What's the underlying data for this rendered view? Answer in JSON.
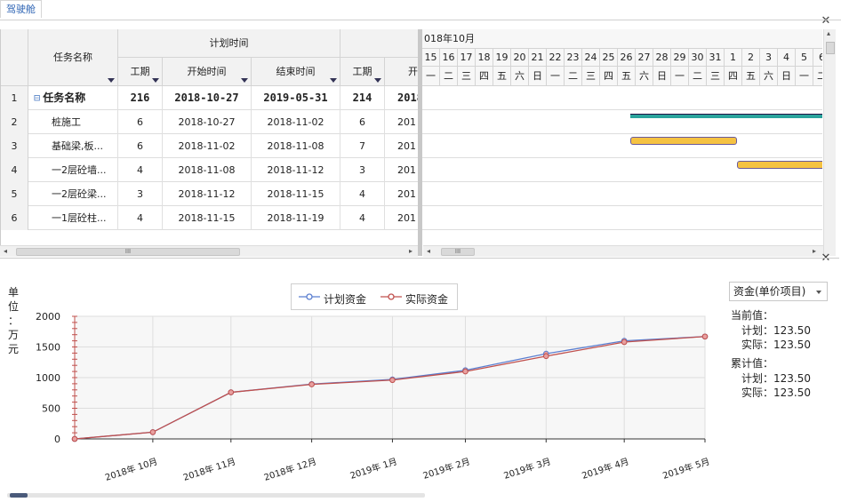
{
  "tab": {
    "label": "驾驶舱"
  },
  "grid": {
    "headers": {
      "task_name": "任务名称",
      "plan_time": "计划时间",
      "duration": "工期",
      "start": "开始时间",
      "end": "结束时间",
      "duration2": "工期",
      "start2_partial": "开"
    },
    "rows": [
      {
        "num": "1",
        "name": "任务名称",
        "duration": "216",
        "start": "2018-10-27",
        "end": "2019-05-31",
        "duration2": "214",
        "start2": "2018",
        "summary": true
      },
      {
        "num": "2",
        "name": "桩施工",
        "duration": "6",
        "start": "2018-10-27",
        "end": "2018-11-02",
        "duration2": "6",
        "start2": "201"
      },
      {
        "num": "3",
        "name": "基础梁,板...",
        "duration": "6",
        "start": "2018-11-02",
        "end": "2018-11-08",
        "duration2": "7",
        "start2": "201"
      },
      {
        "num": "4",
        "name": "一2层砼墙...",
        "duration": "4",
        "start": "2018-11-08",
        "end": "2018-11-12",
        "duration2": "3",
        "start2": "201"
      },
      {
        "num": "5",
        "name": "一2层砼梁...",
        "duration": "3",
        "start": "2018-11-12",
        "end": "2018-11-15",
        "duration2": "4",
        "start2": "201"
      },
      {
        "num": "6",
        "name": "一1层砼柱...",
        "duration": "4",
        "start": "2018-11-15",
        "end": "2018-11-19",
        "duration2": "4",
        "start2": "201"
      }
    ],
    "collapse_icon": "minus-box-icon"
  },
  "gantt": {
    "month": "018年10月",
    "days": [
      "15",
      "16",
      "17",
      "18",
      "19",
      "20",
      "21",
      "22",
      "23",
      "24",
      "25",
      "26",
      "27",
      "28",
      "29",
      "30",
      "31",
      "1",
      "2",
      "3",
      "4",
      "5",
      "6"
    ],
    "weekdays": [
      "一",
      "二",
      "三",
      "四",
      "五",
      "六",
      "日",
      "一",
      "二",
      "三",
      "四",
      "五",
      "六",
      "日",
      "一",
      "二",
      "三",
      "四",
      "五",
      "六",
      "日",
      "一",
      "二"
    ],
    "summary_bar_color": "#2aa39c",
    "task_bar_color": "#f5c242"
  },
  "scroll": {
    "thumb_label": "III"
  },
  "chart_panel": {
    "unit_label": [
      "单",
      "位",
      "：",
      "万",
      "元"
    ],
    "select_value": "资金(单价项目)",
    "current_label": "当前值：",
    "current_plan": "计划：123.50",
    "current_actual": "实际：123.50",
    "cumulative_label": "累计值：",
    "cumulative_plan": "计划：123.50",
    "cumulative_actual": "实际：123.50"
  },
  "chart_data": {
    "type": "line",
    "x": [
      "2018-10-01",
      "2018-10-31",
      "2018-11-30",
      "2018-12-31",
      "2019-01-31",
      "2019-02-28",
      "2019-03-31",
      "2019-04-30",
      "2019-05-31"
    ],
    "xticks": [
      "2018年 10月",
      "2018年 11月",
      "2018年 12月",
      "2019年 1月",
      "2019年 2月",
      "2019年 3月",
      "2019年 4月",
      "2019年 5月"
    ],
    "series": [
      {
        "name": "计划资金",
        "color": "#5b7fd0",
        "values": [
          0,
          110,
          760,
          895,
          970,
          1120,
          1390,
          1600,
          1670
        ]
      },
      {
        "name": "实际资金",
        "color": "#c0504d",
        "values": [
          0,
          110,
          760,
          890,
          960,
          1100,
          1350,
          1580,
          1670
        ]
      }
    ],
    "ylim": [
      0,
      2000
    ],
    "yticks": [
      0,
      500,
      1000,
      1500,
      2000
    ],
    "grid": true,
    "legend": "top-center"
  }
}
